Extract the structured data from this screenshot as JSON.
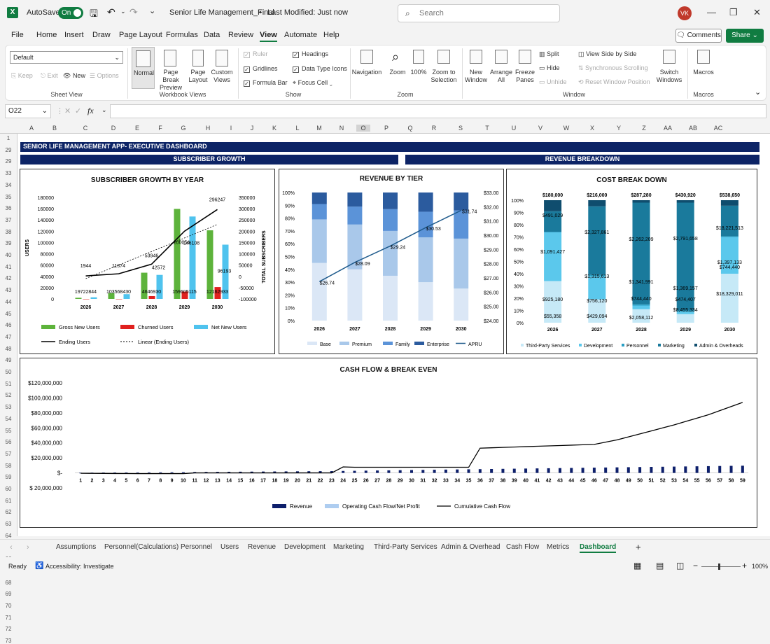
{
  "app": {
    "autosave_label": "AutoSave",
    "autosave_state": "On",
    "doc_title": "Senior Life Management_Final",
    "modified": "Last Modified: Just now",
    "search_placeholder": "Search",
    "user_initials": "VK"
  },
  "ribbon_tabs": [
    "File",
    "Home",
    "Insert",
    "Draw",
    "Page Layout",
    "Formulas",
    "Data",
    "Review",
    "View",
    "Automate",
    "Help"
  ],
  "active_tab": "View",
  "comments_label": "Comments",
  "share_label": "Share",
  "ribbon": {
    "sheet_view": {
      "dropdown": "Default",
      "keep": "Keep",
      "exit": "Exit",
      "new": "New",
      "options": "Options",
      "group": "Sheet View"
    },
    "workbook_views": {
      "normal": "Normal",
      "page_break": "Page Break Preview",
      "page_layout": "Page Layout",
      "custom": "Custom Views",
      "group": "Workbook Views"
    },
    "show": {
      "ruler": "Ruler",
      "gridlines": "Gridlines",
      "formula_bar": "Formula Bar",
      "headings": "Headings",
      "data_type_icons": "Data Type Icons",
      "focus_cell": "Focus Cell",
      "group": "Show"
    },
    "zoom": {
      "navigation": "Navigation",
      "zoom": "Zoom",
      "hundred": "100%",
      "zoom_selection": "Zoom to Selection",
      "group": "Zoom"
    },
    "window": {
      "new_window": "New Window",
      "arrange_all": "Arrange All",
      "freeze": "Freeze Panes",
      "split": "Split",
      "hide": "Hide",
      "unhide": "Unhide",
      "side_by_side": "View Side by Side",
      "sync_scroll": "Synchronous Scrolling",
      "reset_pos": "Reset Window Position",
      "switch": "Switch Windows",
      "group": "Window"
    },
    "macros": {
      "macros": "Macros",
      "group": "Macros"
    }
  },
  "formula_bar": {
    "name_box": "O22",
    "fx": "fx"
  },
  "columns": [
    "A",
    "B",
    "C",
    "D",
    "E",
    "F",
    "G",
    "H",
    "I",
    "J",
    "K",
    "L",
    "M",
    "N",
    "O",
    "P",
    "Q",
    "R",
    "S",
    "T",
    "U",
    "V",
    "W",
    "X",
    "Y",
    "Z",
    "AA",
    "AB",
    "AC"
  ],
  "rows": [
    "1",
    "29",
    "29",
    "33",
    "34",
    "35",
    "36",
    "37",
    "38",
    "39",
    "40",
    "41",
    "42",
    "43",
    "44",
    "45",
    "46",
    "47",
    "48",
    "49",
    "50",
    "51",
    "52",
    "53",
    "54",
    "55",
    "56",
    "57",
    "58",
    "59",
    "60",
    "61",
    "62",
    "63",
    "64",
    "65",
    "66",
    "67",
    "68",
    "69",
    "70",
    "71",
    "72",
    "73"
  ],
  "dashboard": {
    "header": "SENIOR LIFE MANAGEMENT APP- EXECUTIVE DASHBOARD",
    "band_left": "SUBSCRIBER GROWTH",
    "band_right": "REVENUE BREAKDOWN"
  },
  "chart_data": [
    {
      "type": "bar",
      "title": "SUBSCRIBER GROWTH BY YEAR",
      "categories": [
        "2026",
        "2027",
        "2028",
        "2029",
        "2030"
      ],
      "ylabel": "USERS",
      "y2label": "TOTAL SUBSCRIBERS",
      "ylim": [
        0,
        180000
      ],
      "y2lim": [
        -100000,
        350000
      ],
      "yticks": [
        "180000",
        "160000",
        "140000",
        "120000",
        "100000",
        "80000",
        "60000",
        "40000",
        "20000",
        "0"
      ],
      "y2ticks": [
        "350000",
        "300000",
        "250000",
        "200000",
        "150000",
        "100000",
        "50000",
        "0",
        "-50000",
        "-100000"
      ],
      "series": [
        {
          "name": "Gross New Users",
          "values": [
            1972,
            10356,
            46469,
            159605,
            121629
          ],
          "labels": [
            "1972",
            "10356",
            "46469",
            "159605",
            "121629"
          ],
          "color": "#5db33b"
        },
        {
          "name": "Churned Users",
          "values": [
            0,
            0,
            5000,
            13000,
            21000
          ],
          "labels": [
            "",
            "",
            "",
            "",
            ""
          ],
          "color": "#e0201e"
        },
        {
          "name": "Net New Users",
          "values": [
            2844,
            8430,
            42572,
            146108,
            96193
          ],
          "labels": [
            "2844",
            "8430",
            "42572",
            "146108",
            "96193"
          ],
          "color": "#4fc3ee"
        }
      ],
      "bar_labels": [
        "19722844",
        "103568430",
        "4646930",
        "159605115",
        "12162933"
      ],
      "lines": [
        {
          "name": "Ending Users",
          "values": [
            1944,
            11374,
            53946,
            200054,
            296247
          ],
          "labels": [
            "1944",
            "11374",
            "53946",
            "200054",
            "296247"
          ],
          "axis": "right"
        },
        {
          "name": "Linear (Ending Users)",
          "style": "dotted",
          "axis": "right"
        }
      ],
      "legend": [
        "Gross New Users",
        "Churned Users",
        "Net New Users",
        "Ending Users",
        "Linear (Ending Users)"
      ]
    },
    {
      "type": "bar",
      "stacked": true,
      "title": "REVENUE BY TIER",
      "categories": [
        "2026",
        "2027",
        "2028",
        "2029",
        "2030"
      ],
      "yticks": [
        "100%",
        "90%",
        "80%",
        "70%",
        "60%",
        "50%",
        "40%",
        "30%",
        "20%",
        "10%",
        "0%"
      ],
      "y2ticks": [
        "$33.00",
        "$32.00",
        "$31.00",
        "$30.00",
        "$29.00",
        "$28.00",
        "$27.00",
        "$26.00",
        "$25.00",
        "$24.00"
      ],
      "y2lim": [
        24,
        33
      ],
      "series": [
        {
          "name": "Base",
          "values": [
            45,
            40,
            35,
            30,
            25
          ],
          "color": "#dbe7f6"
        },
        {
          "name": "Premium",
          "values": [
            34,
            35,
            35,
            35,
            39
          ],
          "color": "#a9c8ea"
        },
        {
          "name": "Family",
          "values": [
            12,
            14,
            17,
            20,
            22
          ],
          "color": "#5b93d8"
        },
        {
          "name": "Enterprise",
          "values": [
            9,
            11,
            13,
            15,
            14
          ],
          "color": "#2b5b9e"
        }
      ],
      "line": {
        "name": "APRU",
        "values": [
          26.74,
          28.09,
          29.24,
          30.53,
          31.74
        ],
        "labels": [
          "$26.74",
          "$28.09",
          "$29.24",
          "$30.53",
          "$31.74"
        ]
      },
      "legend": [
        "Base",
        "Premium",
        "Family",
        "Enterprise",
        "APRU"
      ]
    },
    {
      "type": "bar",
      "stacked": true,
      "title": "COST BREAK DOWN",
      "categories": [
        "2026",
        "2027",
        "2028",
        "2029",
        "2030"
      ],
      "yticks": [
        "100%",
        "90%",
        "80%",
        "70%",
        "60%",
        "50%",
        "40%",
        "30%",
        "20%",
        "10%",
        "0%"
      ],
      "totals": [
        "$180,000",
        "$216,000",
        "$287,280",
        "$430,920",
        "$538,650"
      ],
      "series": [
        {
          "name": "Third-Party Services",
          "values": [
            34,
            19,
            11,
            7,
            40
          ],
          "color": "#c6e9f7"
        },
        {
          "name": "Development",
          "values": [
            40,
            19,
            3,
            2,
            30
          ],
          "color": "#5bc8ec"
        },
        {
          "name": "Personnel",
          "values": [
            0,
            1,
            1,
            1,
            0.5
          ],
          "color": "#2a9fc4"
        },
        {
          "name": "Marketing",
          "values": [
            17,
            56,
            83,
            88,
            25
          ],
          "color": "#1a7a9c"
        },
        {
          "name": "Admin & Overheads",
          "values": [
            9,
            5,
            2,
            2,
            4.5
          ],
          "color": "#0f4d6e"
        }
      ],
      "value_labels": [
        [
          "$55,358",
          "$925,180",
          "$1,091,427",
          "$491,029"
        ],
        [
          "$429,094",
          "$756,120",
          "$1,315,613",
          "$2,327,861"
        ],
        [
          "$2,058,112",
          "$744,440",
          "$1,341,991",
          "$2,262,209"
        ],
        [
          "$8,455,334",
          "$474,407",
          "$1,369,157",
          "$2,791,658"
        ],
        [
          "$18,329,011",
          "$744,440",
          "$1,397,133",
          "$18,221,513"
        ]
      ],
      "legend": [
        "Third-Party Services",
        "Development",
        "Personnel",
        "Marketing",
        "Admin & Overheads"
      ]
    },
    {
      "type": "bar",
      "title": "CASH FLOW & BREAK EVEN",
      "yticks": [
        "$120,000,000",
        "$100,000,000",
        "$80,000,000",
        "$60,000,000",
        "$40,000,000",
        "$20,000,000",
        "$-",
        "$ 20,000,000"
      ],
      "ylim": [
        -20000000,
        120000000
      ],
      "x": [
        "1",
        "2",
        "3",
        "4",
        "5",
        "6",
        "7",
        "8",
        "9",
        "10",
        "11",
        "12",
        "13",
        "14",
        "15",
        "16",
        "17",
        "18",
        "19",
        "20",
        "21",
        "22",
        "23",
        "24",
        "25",
        "26",
        "27",
        "28",
        "29",
        "30",
        "31",
        "32",
        "33",
        "34",
        "35",
        "36",
        "37",
        "38",
        "39",
        "40",
        "41",
        "42",
        "43",
        "44",
        "45",
        "46",
        "47",
        "48",
        "49",
        "50",
        "51",
        "52",
        "53",
        "54",
        "55",
        "56",
        "57",
        "58",
        "59"
      ],
      "series": [
        {
          "name": "Revenue",
          "color": "#0d1f6b",
          "values": [
            200000,
            300000,
            400000,
            500000,
            600000,
            700000,
            800000,
            900000,
            1000000,
            1100000,
            1200000,
            1300000,
            1400000,
            1500000,
            1600000,
            1700000,
            1800000,
            1900000,
            2000000,
            2100000,
            2200000,
            2300000,
            2400000,
            2600000,
            2800000,
            3000000,
            3200000,
            3400000,
            3600000,
            3800000,
            4000000,
            4200000,
            4400000,
            4600000,
            4800000,
            5000000,
            5200000,
            5400000,
            5600000,
            5800000,
            6000000,
            6200000,
            6400000,
            6600000,
            6800000,
            7000000,
            7200000,
            7400000,
            7600000,
            7800000,
            8000000,
            8200000,
            8400000,
            8600000,
            8800000,
            9000000,
            9200000,
            9400000,
            9600000
          ]
        },
        {
          "name": "Operating Cash Flow/Net Profit",
          "color": "#aecdf0",
          "values": [
            0,
            0,
            0,
            0,
            0,
            0,
            0,
            0,
            0,
            0,
            0,
            0,
            0,
            0,
            0,
            0,
            0,
            0,
            0,
            0,
            0,
            0,
            0,
            0,
            0,
            0,
            0,
            0,
            0,
            0,
            0,
            0,
            0,
            0,
            0,
            0,
            0,
            0,
            0,
            0,
            0,
            0,
            0,
            0,
            0,
            0,
            0,
            0,
            0,
            0,
            0,
            0,
            0,
            0,
            0,
            0,
            0,
            0,
            0
          ]
        },
        {
          "name": "Cumulative Cash Flow",
          "color": "#000000",
          "values": [
            -500000,
            -600000,
            -700000,
            -800000,
            -900000,
            -1000000,
            -1000000,
            -1000000,
            -1000000,
            -1000000,
            0,
            0,
            0,
            0,
            0,
            0,
            0,
            0,
            0,
            0,
            0,
            0,
            0,
            8000000,
            7500000,
            7500000,
            7500000,
            7500000,
            7500000,
            7500000,
            7500000,
            7500000,
            7500000,
            7500000,
            7500000,
            33000000,
            33500000,
            34000000,
            34500000,
            35000000,
            35500000,
            36000000,
            36500000,
            37000000,
            37500000,
            38000000,
            41000000,
            44000000,
            48000000,
            52000000,
            56000000,
            60000000,
            64000000,
            68500000,
            73000000,
            77500000,
            83000000,
            88500000,
            94000000
          ]
        }
      ],
      "legend": [
        "Revenue",
        "Operating Cash Flow/Net Profit",
        "Cumulative Cash Flow"
      ]
    }
  ],
  "sheet_tabs": [
    "Assumptions",
    "Personnel(Calculations)",
    "Personnel",
    "Users",
    "Revenue",
    "Development",
    "Marketing",
    "Third-Party Services",
    "Admin & Overhead",
    "Cash Flow",
    "Metrics",
    "Dashboard"
  ],
  "active_sheet": "Dashboard",
  "status": {
    "ready": "Ready",
    "accessibility": "Accessibility: Investigate",
    "zoom": "100%"
  }
}
